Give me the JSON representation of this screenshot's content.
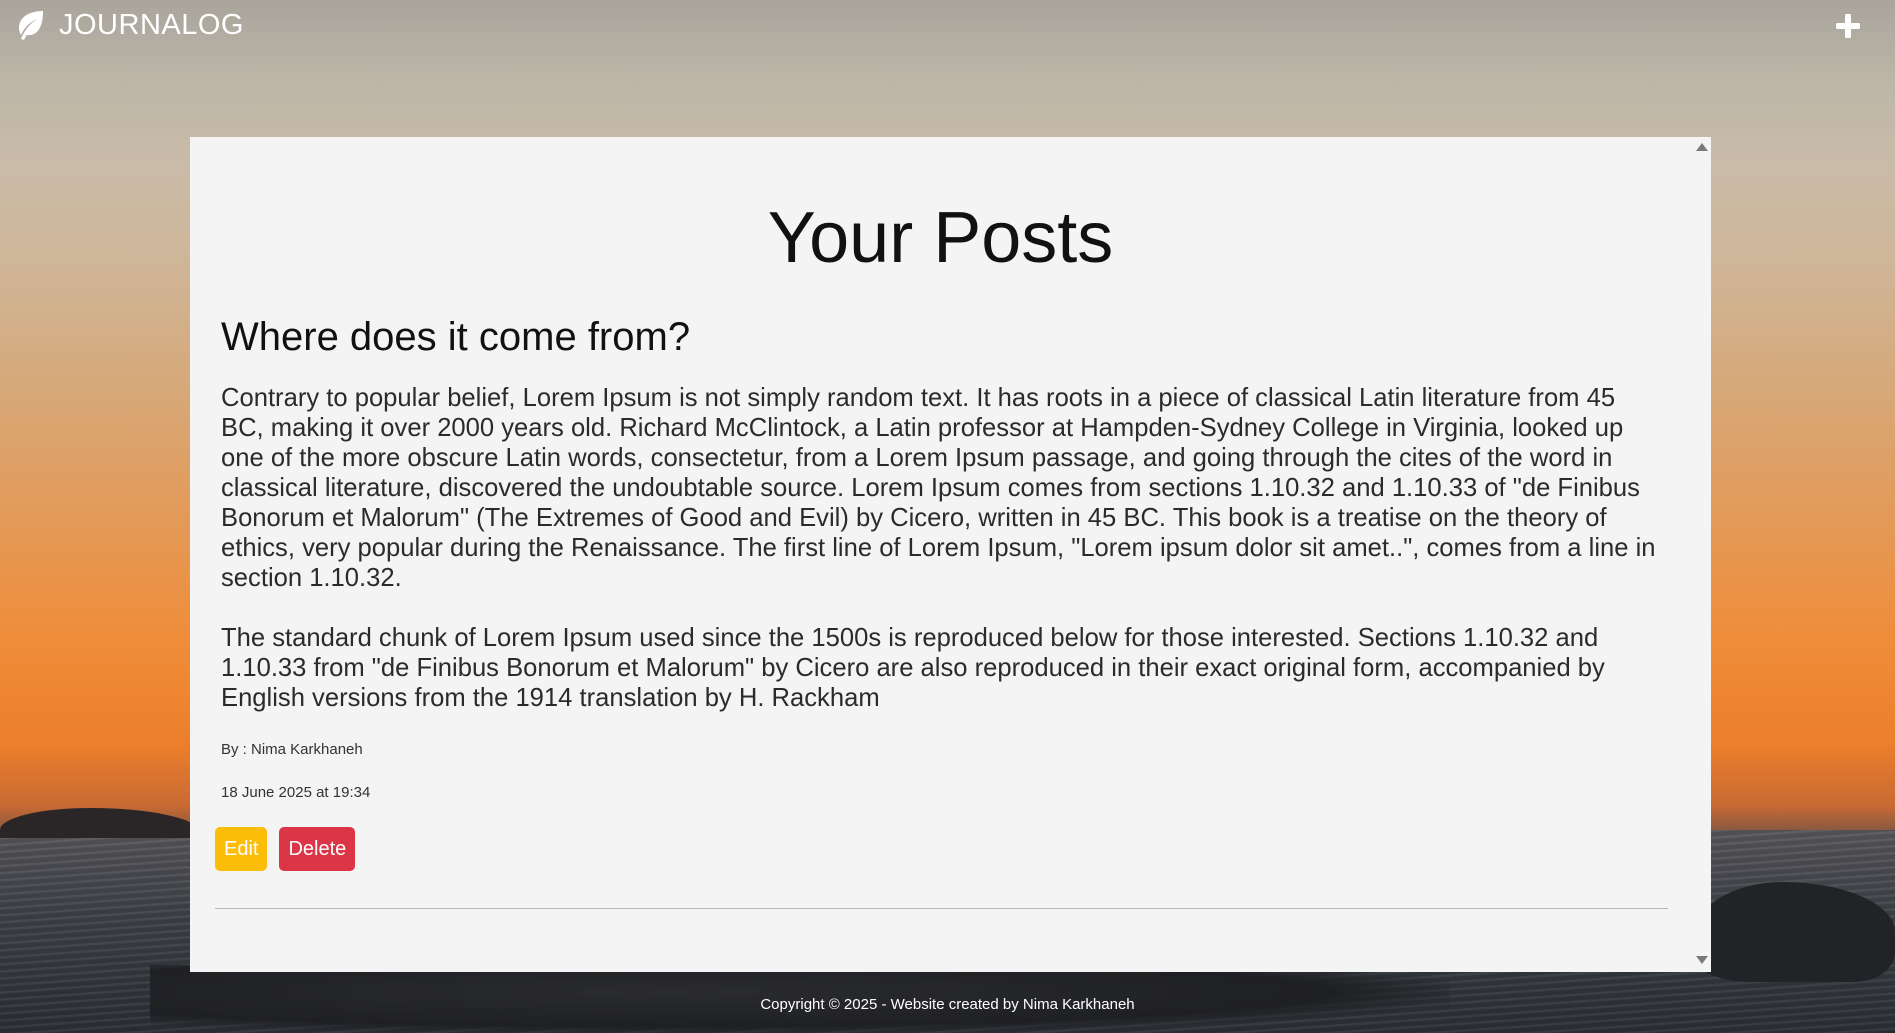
{
  "header": {
    "brand": "JOURNALOG",
    "brand_icon": "leaf-icon",
    "add_icon": "plus-icon"
  },
  "main": {
    "title": "Your Posts"
  },
  "posts": [
    {
      "title": "Where does it come from?",
      "paragraphs": [
        "Contrary to popular belief, Lorem Ipsum is not simply random text. It has roots in a piece of classical Latin literature from 45 BC, making it over 2000 years old. Richard McClintock, a Latin professor at Hampden-Sydney College in Virginia, looked up one of the more obscure Latin words, consectetur, from a Lorem Ipsum passage, and going through the cites of the word in classical literature, discovered the undoubtable source. Lorem Ipsum comes from sections 1.10.32 and 1.10.33 of \"de Finibus Bonorum et Malorum\" (The Extremes of Good and Evil) by Cicero, written in 45 BC. This book is a treatise on the theory of ethics, very popular during the Renaissance. The first line of Lorem Ipsum, \"Lorem ipsum dolor sit amet..\", comes from a line in section 1.10.32.",
        "The standard chunk of Lorem Ipsum used since the 1500s is reproduced below for those interested. Sections 1.10.32 and 1.10.33 from \"de Finibus Bonorum et Malorum\" by Cicero are also reproduced in their exact original form, accompanied by English versions from the 1914 translation by H. Rackham"
      ],
      "author": "By : Nima Karkhaneh",
      "date": "18 June 2025 at 19:34",
      "edit_label": "Edit",
      "delete_label": "Delete"
    }
  ],
  "footer": {
    "text": "Copyright © 2025 - Website created by Nima Karkhaneh"
  },
  "colors": {
    "edit": "#fbbd08",
    "delete": "#dc3545",
    "card": "#f4f4f4"
  }
}
